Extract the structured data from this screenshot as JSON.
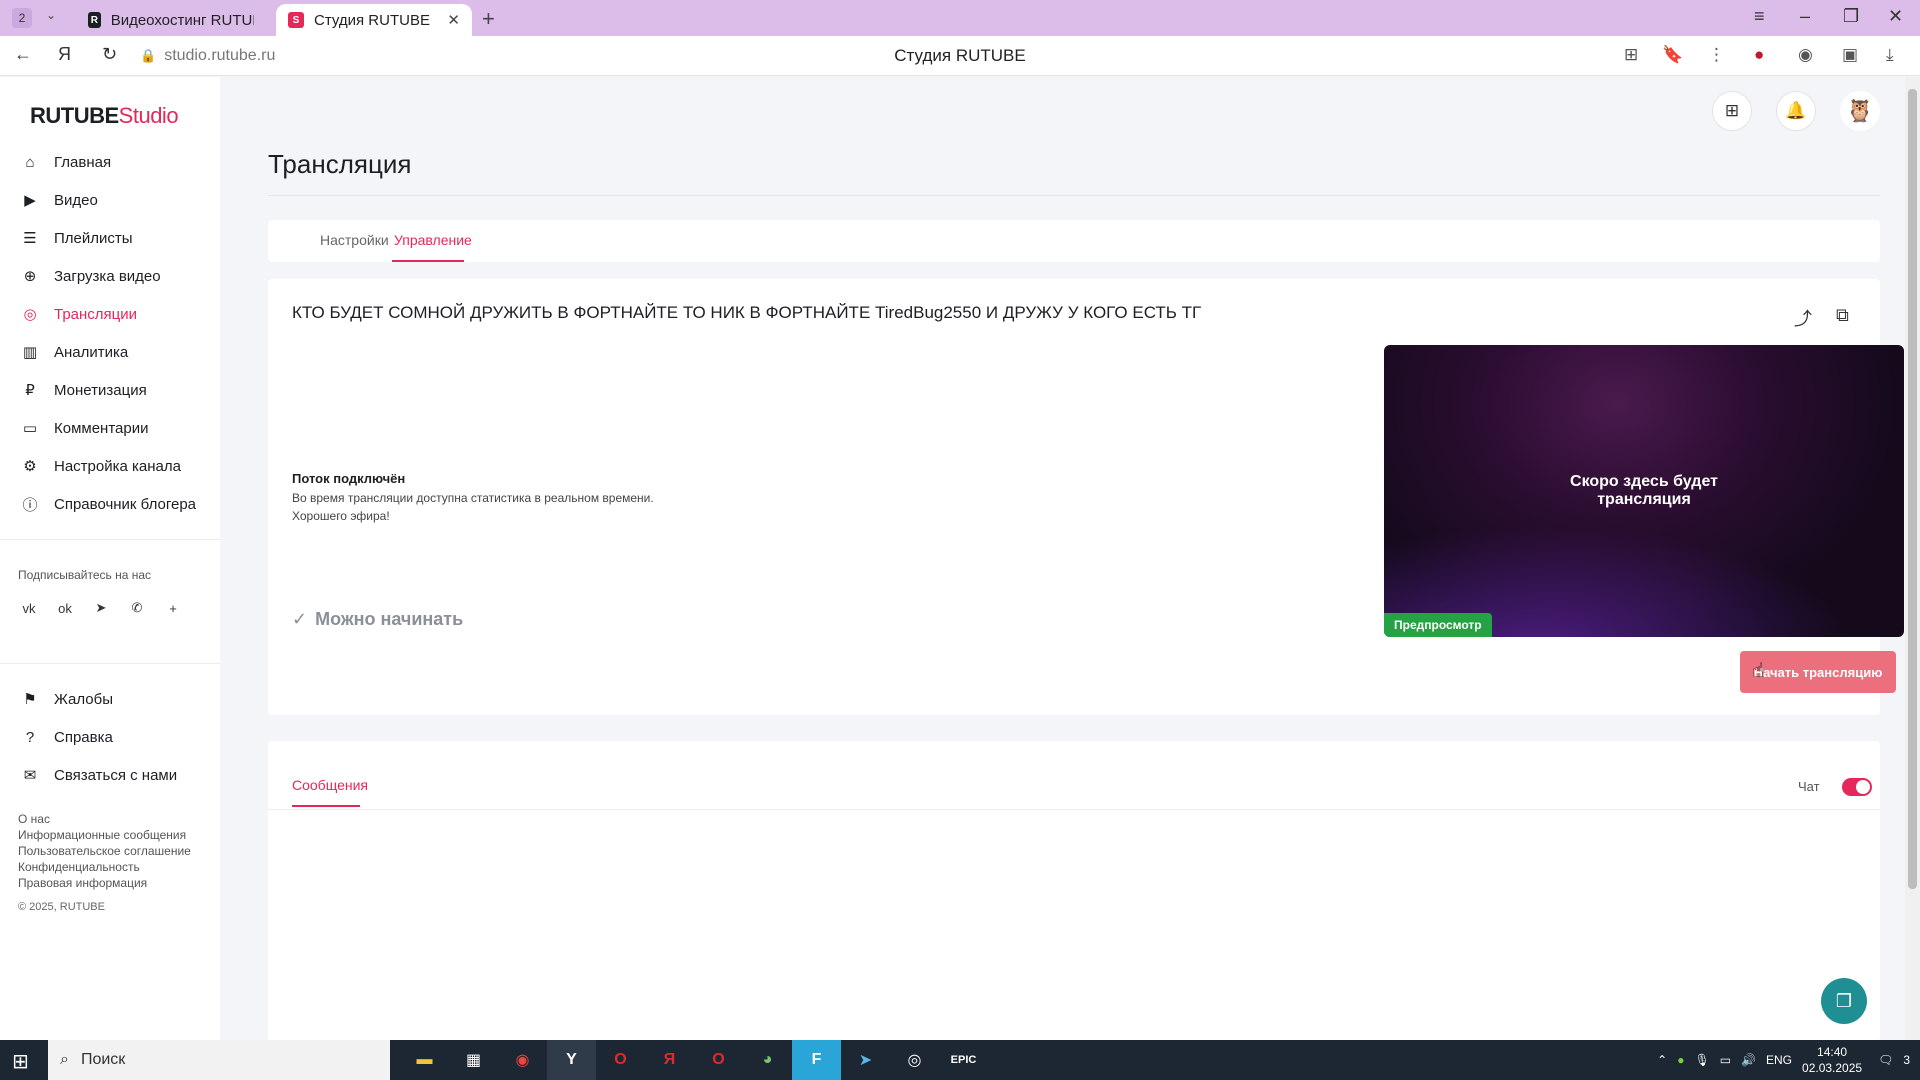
{
  "browser": {
    "tab_count": "2",
    "tabs": [
      {
        "label": "Видеохостинг RUTUBE. С",
        "favicon": "R"
      },
      {
        "label": "Студия RUTUBE",
        "favicon": "S"
      }
    ],
    "url": "studio.rutube.ru",
    "page_title": "Студия RUTUBE",
    "colors": {
      "tabbar": "#dcbdea"
    }
  },
  "sidebar": {
    "logo_main": "RUTUBE",
    "logo_studio": "Studio",
    "items": [
      {
        "label": "Главная",
        "icon": "home-icon"
      },
      {
        "label": "Видео",
        "icon": "video-icon"
      },
      {
        "label": "Плейлисты",
        "icon": "playlist-icon"
      },
      {
        "label": "Загрузка видео",
        "icon": "upload-icon"
      },
      {
        "label": "Трансляции",
        "icon": "broadcast-icon",
        "active": true
      },
      {
        "label": "Аналитика",
        "icon": "analytics-icon"
      },
      {
        "label": "Монетизация",
        "icon": "ruble-icon"
      },
      {
        "label": "Комментарии",
        "icon": "comment-icon"
      },
      {
        "label": "Настройка канала",
        "icon": "gear-icon"
      },
      {
        "label": "Справочник блогера",
        "icon": "info-icon"
      }
    ],
    "social_title": "Подписывайтесь на нас",
    "social": [
      "vk",
      "ok",
      "telegram",
      "viber",
      "plus"
    ],
    "secondary": [
      {
        "label": "Жалобы",
        "icon": "flag-icon"
      },
      {
        "label": "Справка",
        "icon": "help-icon"
      },
      {
        "label": "Связаться с нами",
        "icon": "mail-icon"
      }
    ],
    "footer_links": [
      "О нас",
      "Информационные сообщения",
      "Пользовательское соглашение",
      "Конфиденциальность",
      "Правовая информация"
    ],
    "copyright": "© 2025, RUTUBE"
  },
  "main": {
    "title": "Трансляция",
    "tabs": [
      {
        "label": "Настройки"
      },
      {
        "label": "Управление",
        "active": true
      }
    ],
    "stream": {
      "title": "КТО БУДЕТ СОМНОЙ ДРУЖИТЬ В ФОРТНАЙТЕ ТО НИК В ФОРТНАЙТЕ TiredBug2550 И ДРУЖУ У КОГО ЕСТЬ ТГ",
      "status_heading": "Поток подключён",
      "status_line1": "Во время трансляции доступна статистика в реальном времени.",
      "status_line2": "Хорошего эфира!",
      "ready_label": "Можно начинать",
      "preview_text_line1": "Скоро здесь будет",
      "preview_text_line2": "трансляция",
      "preview_badge": "Предпросмотр",
      "start_button": "Начать трансляцию"
    },
    "chat": {
      "tab_label": "Сообщения",
      "toggle_label": "Чат",
      "toggle_on": true
    },
    "accent_color": "#e5285a"
  },
  "taskbar": {
    "search_placeholder": "Поиск",
    "lang": "ENG",
    "time": "14:40",
    "date": "02.03.2025",
    "notifications": "3"
  }
}
